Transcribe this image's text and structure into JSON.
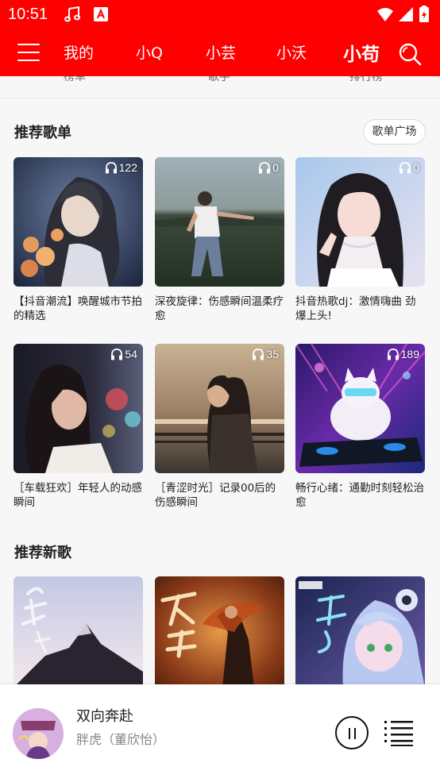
{
  "status_bar": {
    "time": "10:51"
  },
  "nav": {
    "tabs": [
      "我的",
      "小Q",
      "小芸",
      "小沃",
      "小苟"
    ],
    "active_tab": "小苟"
  },
  "peek_labels": [
    "榜单",
    "歌手",
    "排行榜"
  ],
  "playlists": {
    "title": "推荐歌单",
    "more_label": "歌单广场",
    "items": [
      {
        "title": "【抖音潮流】唤醒城市节拍的精选",
        "plays": "122"
      },
      {
        "title": "深夜旋律：伤感瞬间温柔疗愈",
        "plays": "0"
      },
      {
        "title": "抖音热歌dj：激情嗨曲 劲爆上头!",
        "plays": "0"
      },
      {
        "title": "［车载狂欢］年轻人的动感瞬间",
        "plays": "54"
      },
      {
        "title": "［青涩时光］记录00后的伤感瞬间",
        "plays": "35"
      },
      {
        "title": "畅行心绪：通勤时刻轻松治愈",
        "plays": "189"
      }
    ]
  },
  "new_songs": {
    "title": "推荐新歌"
  },
  "player": {
    "title": "双向奔赴",
    "artist": "胖虎（董欣怡）"
  },
  "colors": {
    "accent": "#ff0000"
  },
  "icons": [
    "music-note-icon",
    "a-badge-icon",
    "wifi-icon",
    "signal-icon",
    "battery-icon",
    "menu-icon",
    "search-icon",
    "headphone-icon",
    "pause-icon",
    "playlist-icon"
  ]
}
